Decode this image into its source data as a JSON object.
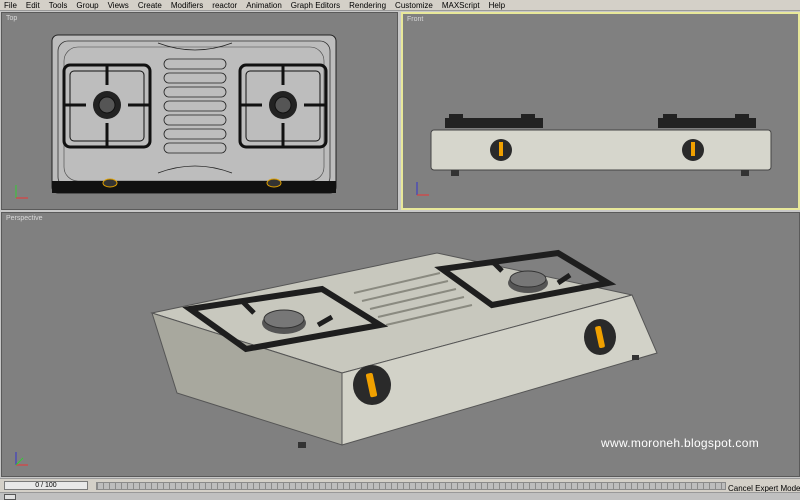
{
  "menu": {
    "items": [
      "File",
      "Edit",
      "Tools",
      "Group",
      "Views",
      "Create",
      "Modifiers",
      "reactor",
      "Animation",
      "Graph Editors",
      "Rendering",
      "Customize",
      "MAXScript",
      "Help"
    ]
  },
  "viewports": {
    "top": {
      "label": "Top"
    },
    "front": {
      "label": "Front",
      "active": true
    },
    "perspective": {
      "label": "Perspective"
    }
  },
  "watermark": "www.moroneh.blogspot.com",
  "status": {
    "frame_readout": "0 / 100",
    "cancel_expert": "Cancel Expert Mode"
  },
  "colors": {
    "viewport_bg": "#808080",
    "active_border": "#e8e89a",
    "stove_body": "#d6d6cc",
    "grate": "#2a2a2a",
    "knob_accent": "#f0a000"
  }
}
